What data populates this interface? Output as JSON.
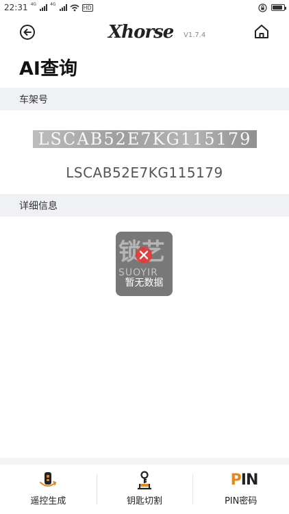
{
  "status_bar": {
    "time": "22:31",
    "net1": "4G",
    "net2": "4G",
    "hd_badge": "HD",
    "battery_level": 0.85
  },
  "header": {
    "logo_text": "Xhorse",
    "version": "V1.7.4"
  },
  "page": {
    "title": "AI查询"
  },
  "vin_section": {
    "label": "车架号",
    "image_text": "LSCAB52E7KG115179",
    "vin": "LSCAB52E7KG115179"
  },
  "detail_section": {
    "label": "详细信息"
  },
  "toast": {
    "watermark_big": "锁艺",
    "watermark_small": "SUOYIR",
    "message": "暂无数据"
  },
  "bottom_nav": {
    "items": [
      {
        "label": "遥控生成",
        "icon": "remote-icon"
      },
      {
        "label": "钥匙切割",
        "icon": "key-cut-icon"
      },
      {
        "label": "PIN密码",
        "icon": "pin-icon"
      }
    ]
  },
  "colors": {
    "accent_orange": "#e8861a",
    "section_bg": "#f0f1f4",
    "toast_bg": "#5a5a5a",
    "error_red": "#e53935"
  }
}
